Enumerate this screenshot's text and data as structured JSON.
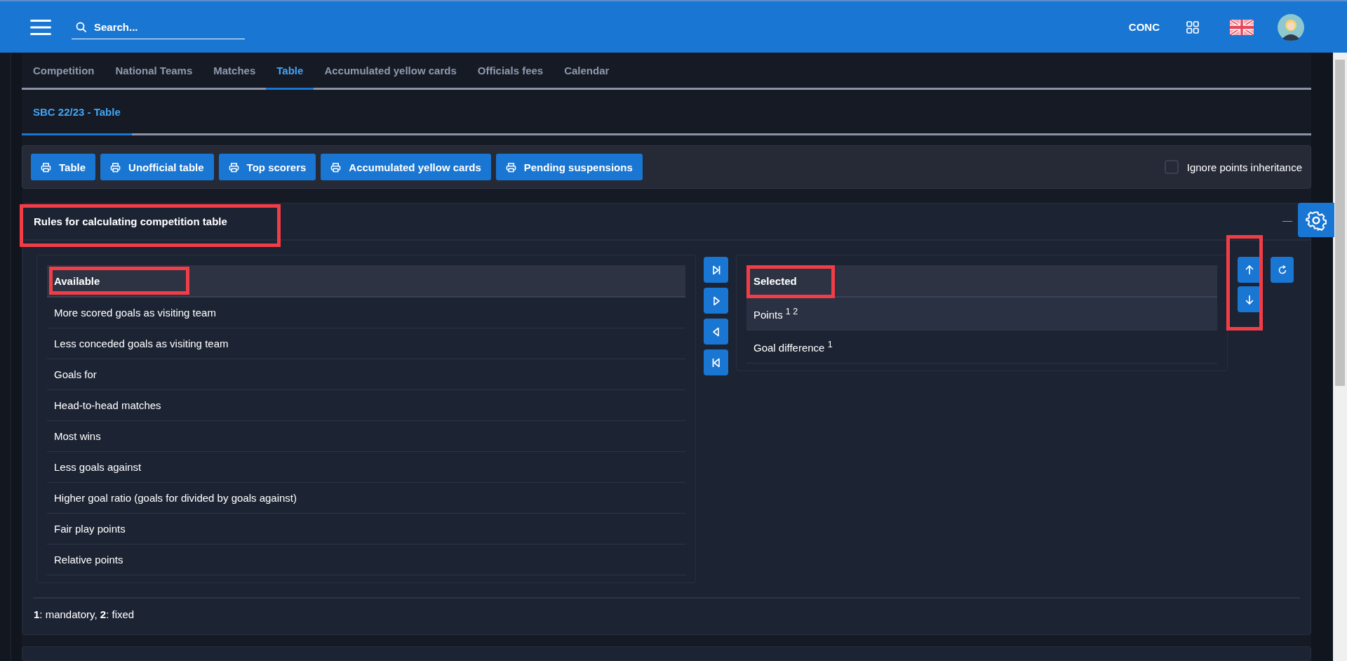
{
  "header": {
    "search": {
      "placeholder": "Search..."
    },
    "org_code": "CONC"
  },
  "tabs": [
    {
      "label": "Competition",
      "selected": false
    },
    {
      "label": "National Teams",
      "selected": false
    },
    {
      "label": "Matches",
      "selected": false
    },
    {
      "label": "Table",
      "selected": true
    },
    {
      "label": "Accumulated yellow cards",
      "selected": false
    },
    {
      "label": "Officials fees",
      "selected": false
    },
    {
      "label": "Calendar",
      "selected": false
    }
  ],
  "subtabs": [
    {
      "label": "SBC 22/23 - Table",
      "selected": true
    }
  ],
  "print_buttons": [
    "Table",
    "Unofficial table",
    "Top scorers",
    "Accumulated yellow cards",
    "Pending suspensions"
  ],
  "ignore_inheritance": {
    "label": "Ignore points inheritance",
    "checked": false
  },
  "rules_panel": {
    "title": "Rules for calculating competition table",
    "available": {
      "heading": "Available",
      "items": [
        {
          "label": "More scored goals as visiting team",
          "selected": false
        },
        {
          "label": "Less conceded goals as visiting team",
          "selected": false
        },
        {
          "label": "Goals for",
          "selected": false
        },
        {
          "label": "Head-to-head matches",
          "selected": false
        },
        {
          "label": "Most wins",
          "selected": false
        },
        {
          "label": "Less goals against",
          "selected": false
        },
        {
          "label": "Higher goal ratio (goals for divided by goals against)",
          "selected": false
        },
        {
          "label": "Fair play points",
          "selected": false
        },
        {
          "label": "Relative points",
          "selected": false
        }
      ]
    },
    "selected": {
      "heading": "Selected",
      "items": [
        {
          "label": "Points $^{1 2}$",
          "selected": true
        },
        {
          "label": "Goal difference $^{1}$",
          "selected": false
        }
      ]
    },
    "footnote": "**1**: mandatory, **2**: fixed"
  }
}
